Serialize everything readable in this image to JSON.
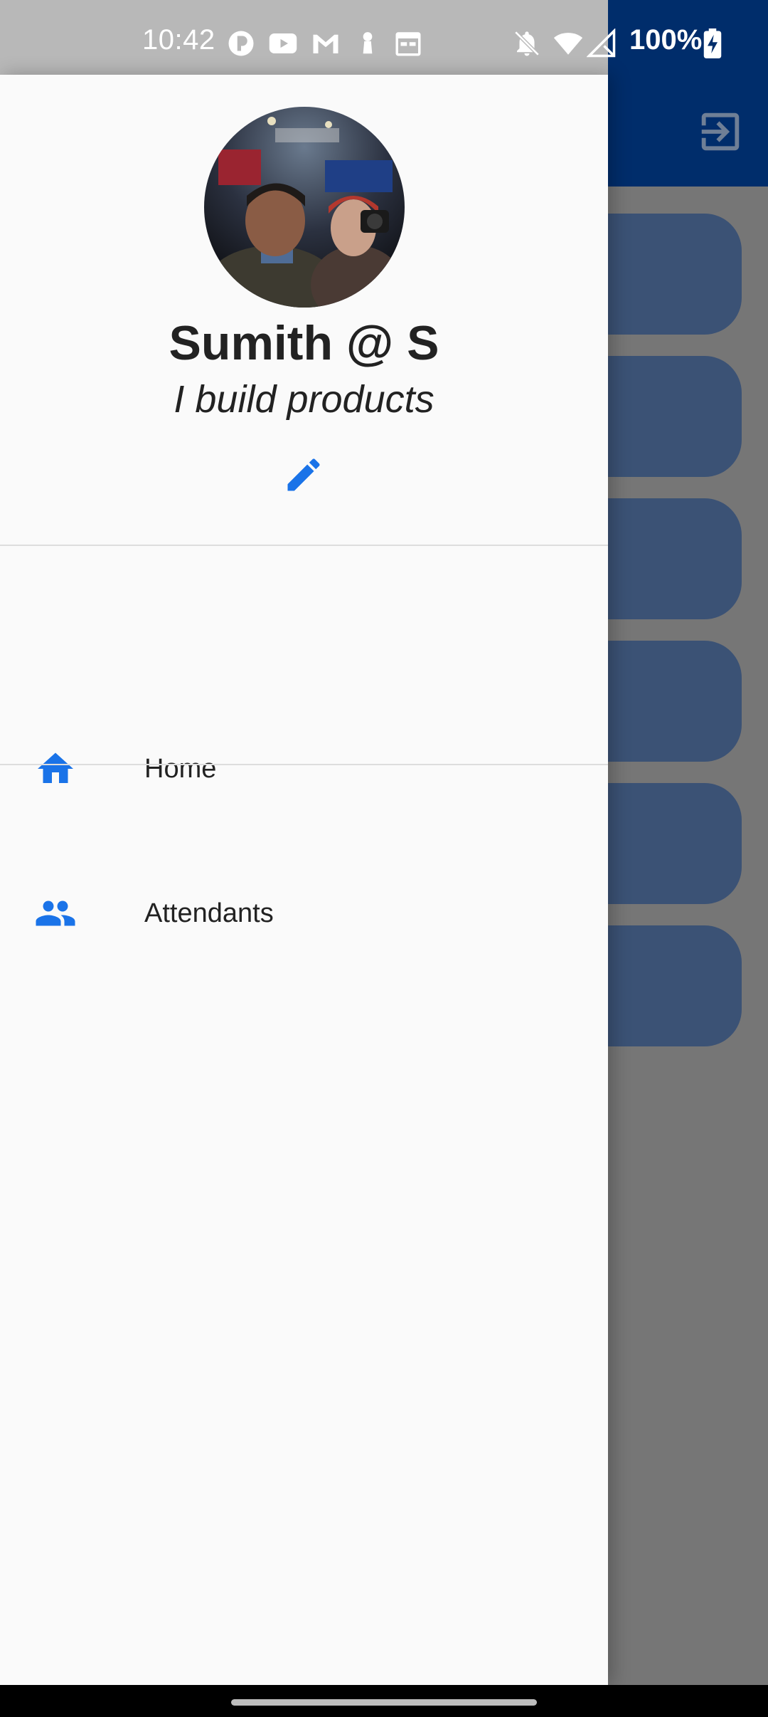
{
  "status_bar": {
    "time": "10:42",
    "battery_percent": "100%",
    "notification_icons": [
      "app-icon",
      "youtube-icon",
      "gmail-icon",
      "keyhole-icon",
      "calendar-icon"
    ],
    "system_icons": [
      "bell-off-icon",
      "wifi-icon",
      "signal-icon",
      "battery-charging-icon"
    ]
  },
  "background_app": {
    "app_bar_color": "#002d6b",
    "action_icon": "logout-icon",
    "card_color": "#3b5275",
    "card_count": 6
  },
  "drawer": {
    "profile": {
      "name": "Sumith @ S",
      "tagline": "I build products",
      "edit_icon": "pencil-icon"
    },
    "items": [
      {
        "label": "Home",
        "icon": "home-icon"
      },
      {
        "label": "Attendants",
        "icon": "people-icon"
      }
    ],
    "accent_color": "#1a73e8"
  }
}
